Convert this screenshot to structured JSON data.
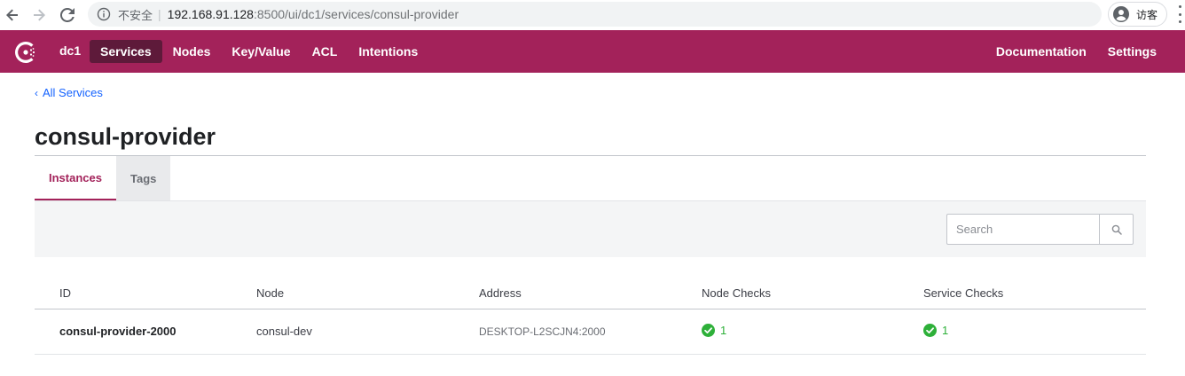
{
  "browser": {
    "security_label": "不安全",
    "separator": "|",
    "url_host": "192.168.91.128",
    "url_path": ":8500/ui/dc1/services/consul-provider",
    "profile_label": "访客"
  },
  "header": {
    "datacenter": "dc1",
    "nav": [
      "Services",
      "Nodes",
      "Key/Value",
      "ACL",
      "Intentions"
    ],
    "active_nav": "Services",
    "right_nav": [
      "Documentation",
      "Settings"
    ],
    "brand_color": "#a3225a"
  },
  "page": {
    "breadcrumb": "All Services",
    "title": "consul-provider",
    "tabs": [
      "Instances",
      "Tags"
    ],
    "active_tab": "Instances"
  },
  "search": {
    "placeholder": "Search",
    "value": ""
  },
  "table": {
    "columns": [
      "ID",
      "Node",
      "Address",
      "Node Checks",
      "Service Checks"
    ],
    "rows": [
      {
        "id": "consul-provider-2000",
        "node": "consul-dev",
        "address": "DESKTOP-L2SCJN4:2000",
        "node_checks": "1",
        "service_checks": "1"
      }
    ]
  },
  "icons": {
    "back": "arrow-left-icon",
    "forward": "arrow-right-icon",
    "reload": "reload-icon",
    "info": "info-icon",
    "profile": "person-icon",
    "menu": "kebab-icon",
    "logo": "consul-logo-icon",
    "search": "search-icon",
    "check": "check-circle-icon"
  },
  "colors": {
    "link": "#1563ff",
    "passing": "#2eb039"
  }
}
